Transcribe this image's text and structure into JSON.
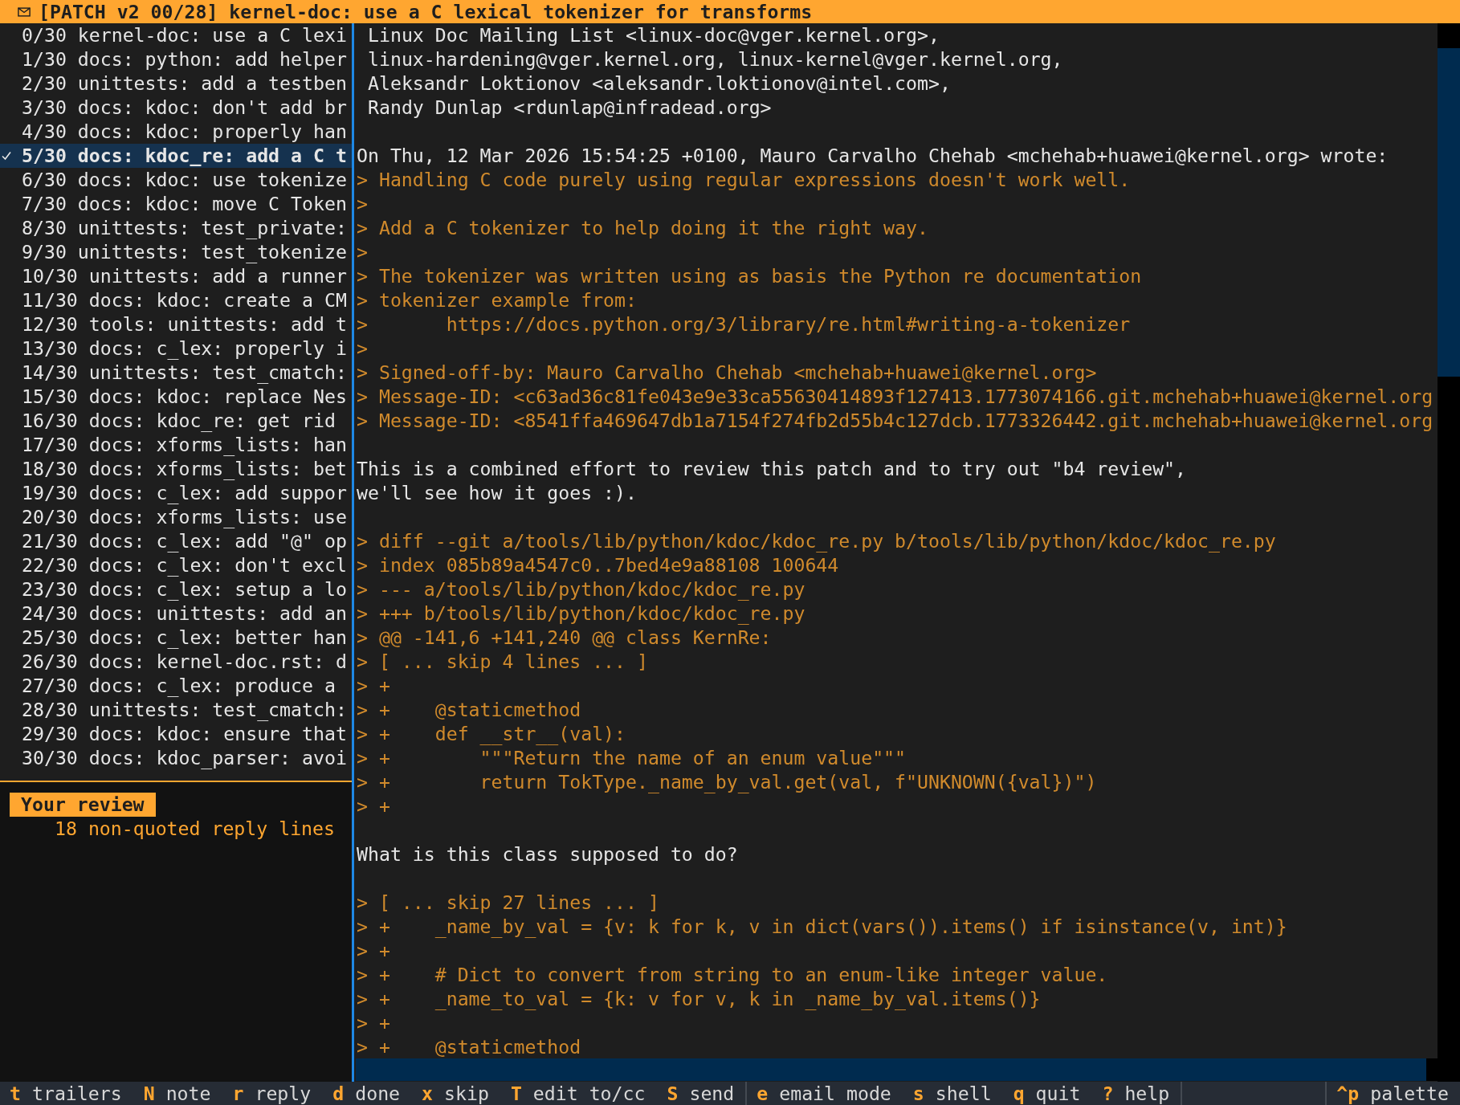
{
  "window": {
    "title": "[PATCH v2 00/28] kernel-doc: use a C lexical tokenizer for transforms"
  },
  "patches": [
    {
      "label": "0/30 kernel-doc: use a C lexi",
      "selected": false,
      "checked": false
    },
    {
      "label": "1/30 docs: python: add helper",
      "selected": false,
      "checked": false
    },
    {
      "label": "2/30 unittests: add a testben",
      "selected": false,
      "checked": false
    },
    {
      "label": "3/30 docs: kdoc: don't add br",
      "selected": false,
      "checked": false
    },
    {
      "label": "4/30 docs: kdoc: properly han",
      "selected": false,
      "checked": false
    },
    {
      "label": "5/30 docs: kdoc_re: add a C t",
      "selected": true,
      "checked": true
    },
    {
      "label": "6/30 docs: kdoc: use tokenize",
      "selected": false,
      "checked": false
    },
    {
      "label": "7/30 docs: kdoc: move C Token",
      "selected": false,
      "checked": false
    },
    {
      "label": "8/30 unittests: test_private:",
      "selected": false,
      "checked": false
    },
    {
      "label": "9/30 unittests: test_tokenize",
      "selected": false,
      "checked": false
    },
    {
      "label": "10/30 unittests: add a runner",
      "selected": false,
      "checked": false
    },
    {
      "label": "11/30 docs: kdoc: create a CM",
      "selected": false,
      "checked": false
    },
    {
      "label": "12/30 tools: unittests: add t",
      "selected": false,
      "checked": false
    },
    {
      "label": "13/30 docs: c_lex: properly i",
      "selected": false,
      "checked": false
    },
    {
      "label": "14/30 unittests: test_cmatch:",
      "selected": false,
      "checked": false
    },
    {
      "label": "15/30 docs: kdoc: replace Nes",
      "selected": false,
      "checked": false
    },
    {
      "label": "16/30 docs: kdoc_re: get rid",
      "selected": false,
      "checked": false
    },
    {
      "label": "17/30 docs: xforms_lists: han",
      "selected": false,
      "checked": false
    },
    {
      "label": "18/30 docs: xforms_lists: bet",
      "selected": false,
      "checked": false
    },
    {
      "label": "19/30 docs: c_lex: add suppor",
      "selected": false,
      "checked": false
    },
    {
      "label": "20/30 docs: xforms_lists: use",
      "selected": false,
      "checked": false
    },
    {
      "label": "21/30 docs: c_lex: add \"@\" op",
      "selected": false,
      "checked": false
    },
    {
      "label": "22/30 docs: c_lex: don't excl",
      "selected": false,
      "checked": false
    },
    {
      "label": "23/30 docs: c_lex: setup a lo",
      "selected": false,
      "checked": false
    },
    {
      "label": "24/30 docs: unittests: add an",
      "selected": false,
      "checked": false
    },
    {
      "label": "25/30 docs: c_lex: better han",
      "selected": false,
      "checked": false
    },
    {
      "label": "26/30 docs: kernel-doc.rst: d",
      "selected": false,
      "checked": false
    },
    {
      "label": "27/30 docs: c_lex: produce a",
      "selected": false,
      "checked": false
    },
    {
      "label": "28/30 unittests: test_cmatch:",
      "selected": false,
      "checked": false
    },
    {
      "label": "29/30 docs: kdoc: ensure that",
      "selected": false,
      "checked": false
    },
    {
      "label": "30/30 docs: kdoc_parser: avoi",
      "selected": false,
      "checked": false
    }
  ],
  "review": {
    "title": "Your review",
    "summary": "18 non-quoted reply lines"
  },
  "message_lines": [
    {
      "kind": "header",
      "text": "Linux Doc Mailing List <linux-doc@vger.kernel.org>,"
    },
    {
      "kind": "header",
      "text": "linux-hardening@vger.kernel.org, linux-kernel@vger.kernel.org,"
    },
    {
      "kind": "header",
      "text": "Aleksandr Loktionov <aleksandr.loktionov@intel.com>,"
    },
    {
      "kind": "header",
      "text": "Randy Dunlap <rdunlap@infradead.org>"
    },
    {
      "kind": "blank"
    },
    {
      "kind": "text",
      "text": "On Thu, 12 Mar 2026 15:54:25 +0100, Mauro Carvalho Chehab <mchehab+huawei@kernel.org> wrote:"
    },
    {
      "kind": "quote",
      "text": "> Handling C code purely using regular expressions doesn't work well."
    },
    {
      "kind": "quote",
      "text": ">"
    },
    {
      "kind": "quote",
      "text": "> Add a C tokenizer to help doing it the right way."
    },
    {
      "kind": "quote",
      "text": ">"
    },
    {
      "kind": "quote",
      "text": "> The tokenizer was written using as basis the Python re documentation"
    },
    {
      "kind": "quote",
      "text": "> tokenizer example from:"
    },
    {
      "kind": "quote",
      "text": ">       https://docs.python.org/3/library/re.html#writing-a-tokenizer"
    },
    {
      "kind": "quote",
      "text": ">"
    },
    {
      "kind": "quote",
      "text": "> Signed-off-by: Mauro Carvalho Chehab <mchehab+huawei@kernel.org>"
    },
    {
      "kind": "quote",
      "text": "> Message-ID: <c63ad36c81fe043e9e33ca55630414893f127413.1773074166.git.mchehab+huawei@kernel.org"
    },
    {
      "kind": "quote",
      "text": "> Message-ID: <8541ffa469647db1a7154f274fb2d55b4c127dcb.1773326442.git.mchehab+huawei@kernel.org"
    },
    {
      "kind": "blank"
    },
    {
      "kind": "text",
      "text": "This is a combined effort to review this patch and to try out \"b4 review\","
    },
    {
      "kind": "text",
      "text": "we'll see how it goes :)."
    },
    {
      "kind": "blank"
    },
    {
      "kind": "quote",
      "text": "> diff --git a/tools/lib/python/kdoc/kdoc_re.py b/tools/lib/python/kdoc/kdoc_re.py"
    },
    {
      "kind": "quote",
      "text": "> index 085b89a4547c0..7bed4e9a88108 100644"
    },
    {
      "kind": "quote",
      "text": "> --- a/tools/lib/python/kdoc/kdoc_re.py"
    },
    {
      "kind": "quote",
      "text": "> +++ b/tools/lib/python/kdoc/kdoc_re.py"
    },
    {
      "kind": "quote",
      "text": "> @@ -141,6 +141,240 @@ class KernRe:"
    },
    {
      "kind": "quote",
      "text": "> [ ... skip 4 lines ... ]"
    },
    {
      "kind": "quote",
      "text": "> +"
    },
    {
      "kind": "quote",
      "text": "> +    @staticmethod"
    },
    {
      "kind": "quote",
      "text": "> +    def __str__(val):"
    },
    {
      "kind": "quote",
      "text": "> +        \"\"\"Return the name of an enum value\"\"\""
    },
    {
      "kind": "quote",
      "text": "> +        return TokType._name_by_val.get(val, f\"UNKNOWN({val})\")"
    },
    {
      "kind": "quote",
      "text": "> +"
    },
    {
      "kind": "blank"
    },
    {
      "kind": "text",
      "text": "What is this class supposed to do?"
    },
    {
      "kind": "blank"
    },
    {
      "kind": "quote",
      "text": "> [ ... skip 27 lines ... ]"
    },
    {
      "kind": "quote",
      "text": "> +    _name_by_val = {v: k for k, v in dict(vars()).items() if isinstance(v, int)}"
    },
    {
      "kind": "quote",
      "text": "> +"
    },
    {
      "kind": "quote",
      "text": "> +    # Dict to convert from string to an enum-like integer value."
    },
    {
      "kind": "quote",
      "text": "> +    _name_to_val = {k: v for v, k in _name_by_val.items()}"
    },
    {
      "kind": "quote",
      "text": "> +"
    },
    {
      "kind": "quote",
      "text": "> +    @staticmethod"
    }
  ],
  "status_bar": {
    "groups": [
      [
        {
          "key": "t",
          "label": "trailers"
        },
        {
          "key": "N",
          "label": "note"
        },
        {
          "key": "r",
          "label": "reply"
        },
        {
          "key": "d",
          "label": "done"
        },
        {
          "key": "x",
          "label": "skip"
        },
        {
          "key": "T",
          "label": "edit to/cc"
        },
        {
          "key": "S",
          "label": "send"
        }
      ],
      [
        {
          "key": "e",
          "label": "email mode"
        },
        {
          "key": "s",
          "label": "shell"
        },
        {
          "key": "q",
          "label": "quit"
        },
        {
          "key": "?",
          "label": "help"
        }
      ],
      [
        {
          "key": "^p",
          "label": "palette"
        }
      ]
    ]
  }
}
